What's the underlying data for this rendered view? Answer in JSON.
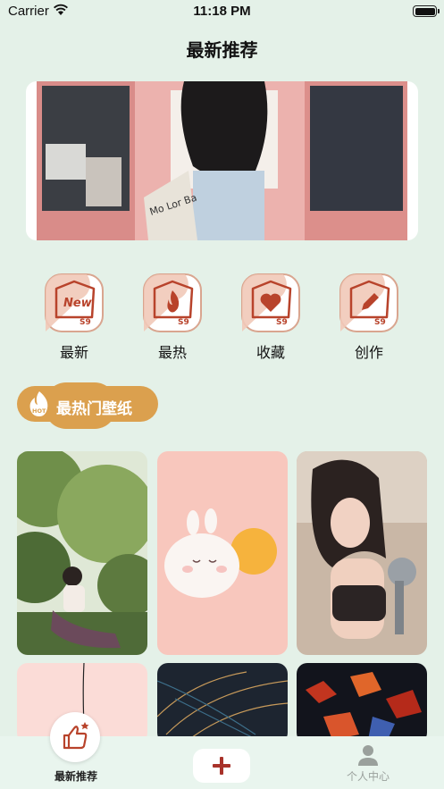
{
  "status_bar": {
    "carrier": "Carrier",
    "time": "11:18 PM"
  },
  "header": {
    "title": "最新推荐"
  },
  "categories": [
    {
      "label": "最新",
      "icon": "new-badge-icon",
      "badge": "New",
      "sub": "S9"
    },
    {
      "label": "最热",
      "icon": "flame-icon",
      "sub": "S9"
    },
    {
      "label": "收藏",
      "icon": "heart-icon",
      "sub": "S9"
    },
    {
      "label": "创作",
      "icon": "pencil-icon",
      "sub": "S9"
    }
  ],
  "hot_section": {
    "title": "最热门壁纸",
    "badge": "HOT"
  },
  "tab_bar": {
    "home_label": "最新推荐",
    "profile_label": "个人中心"
  },
  "colors": {
    "background": "#e4f1e8",
    "accent_orange": "#dba04e",
    "icon_red": "#b8432b",
    "icon_bg": "#f3d3c4"
  }
}
